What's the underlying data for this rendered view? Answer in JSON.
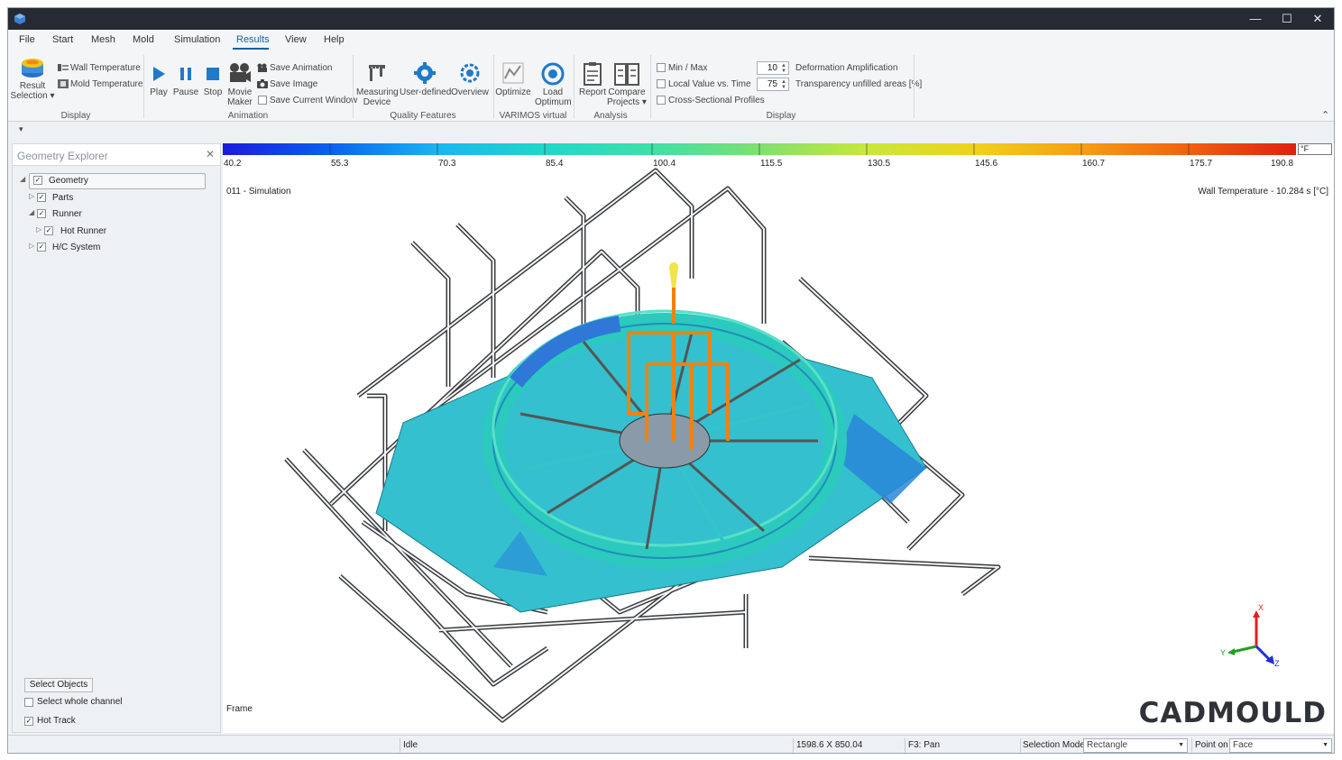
{
  "window": {
    "buttons": {
      "minimize": "—",
      "maximize": "☐",
      "close": "✕"
    }
  },
  "menu": [
    "File",
    "Start",
    "Mesh",
    "Mold",
    "Simulation",
    "Results",
    "View",
    "Help"
  ],
  "menu_active": "Results",
  "ribbon": {
    "result_selection": "Result\nSelection ▾",
    "wall_temperature": "Wall Temperature",
    "mold_temperature": "Mold Temperature",
    "display_group": "Display",
    "play": "Play",
    "pause": "Pause",
    "stop": "Stop",
    "movie_maker": "Movie\nMaker",
    "save_animation": "Save Animation",
    "save_image": "Save Image",
    "save_current_window": "Save Current Window",
    "animation_group": "Animation",
    "measuring_device": "Measuring\nDevice",
    "user_defined": "User-defined",
    "overview": "Overview",
    "quality_group": "Quality Features",
    "optimize": "Optimize",
    "load_optimum": "Load\nOptimum",
    "varimos_group": "VARIMOS virtual",
    "report": "Report",
    "compare_projects": "Compare\nProjects ▾",
    "analysis_group": "Analysis",
    "min_max": "Min / Max",
    "local_value": "Local Value vs. Time",
    "cross_sectional": "Cross-Sectional Profiles",
    "deformation_value": "10",
    "deformation_label": "Deformation Amplification",
    "transparency_value": "75",
    "transparency_label": "Transparency unfilled areas [%]",
    "display_group2": "Display",
    "collapse_glyph": "⌃",
    "expand_glyph": "▾"
  },
  "explorer": {
    "title": "Geometry Explorer",
    "close": "✕",
    "tree": [
      {
        "label": "Geometry",
        "level": 0,
        "twisty": "◢",
        "checked": true
      },
      {
        "label": "Parts",
        "level": 1,
        "twisty": "▷",
        "checked": true
      },
      {
        "label": "Runner",
        "level": 1,
        "twisty": "◢",
        "checked": true
      },
      {
        "label": "Hot Runner",
        "level": 2,
        "twisty": "▷",
        "checked": true
      },
      {
        "label": "H/C System",
        "level": 1,
        "twisty": "▷",
        "checked": true
      }
    ],
    "select_objects": "Select Objects",
    "select_whole_channel": "Select whole channel",
    "select_whole_channel_checked": false,
    "hot_track": "Hot Track",
    "hot_track_checked": true
  },
  "viewport": {
    "scale_labels": [
      "40.2",
      "55.3",
      "70.3",
      "85.4",
      "100.4",
      "115.5",
      "130.5",
      "145.6",
      "160.7",
      "175.7",
      "190.8"
    ],
    "unit": "°F",
    "simulation": "011 - Simulation",
    "result": "Wall Temperature - 10.284 s [°C]",
    "frame": "Frame",
    "brand": "CADMOULD",
    "axes": {
      "x": "X",
      "y": "Y",
      "z": "Z"
    }
  },
  "status": {
    "state": "Idle",
    "dimensions": "1598.6 X 850.04",
    "hint": "F3: Pan",
    "selection_mode_label": "Selection Mode",
    "selection_mode_value": "Rectangle",
    "point_on_label": "Point on",
    "point_on_value": "Face"
  },
  "colors": {
    "accent": "#1b5f9e",
    "scale": [
      "#1a1adf",
      "#0a60f0",
      "#19b6f0",
      "#20d8c8",
      "#3ee0a8",
      "#7ee070",
      "#c8e83a",
      "#f0d21a",
      "#f4a012",
      "#f06010",
      "#e02010"
    ],
    "runner": "#f0820e"
  }
}
